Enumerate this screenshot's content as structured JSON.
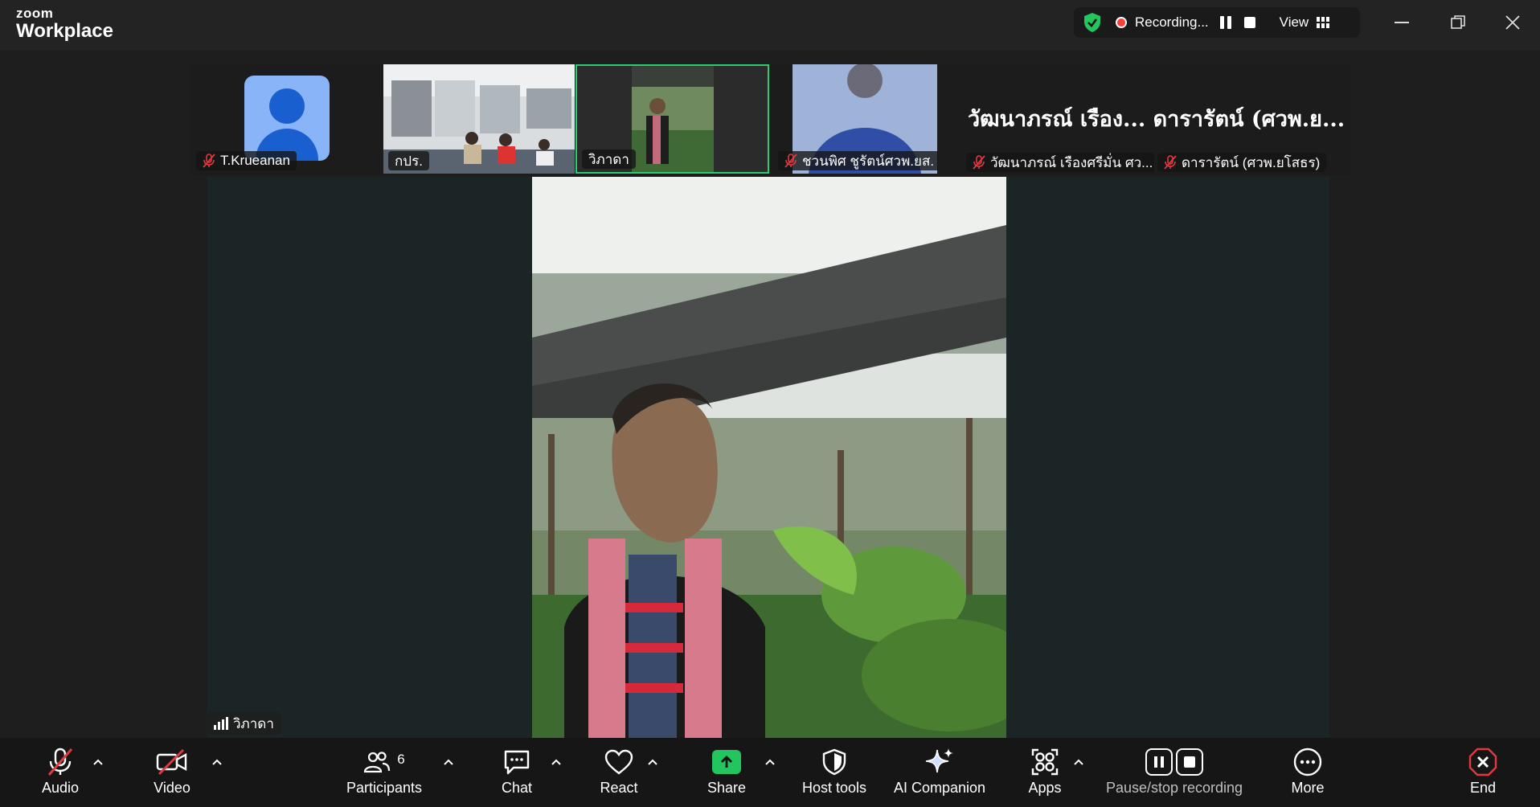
{
  "app": {
    "brand_top": "zoom",
    "brand_bottom": "Workplace"
  },
  "recording": {
    "status": "Recording...",
    "view_label": "View"
  },
  "participants_strip": [
    {
      "name": "T.Krueanan",
      "muted": true,
      "type": "avatar"
    },
    {
      "name": "กปร.",
      "muted": false,
      "type": "video"
    },
    {
      "name": "วิภาดา",
      "muted": false,
      "type": "video",
      "active": true
    },
    {
      "name": "ชวนพิศ ชูรัตน์ศวพ.ยส.",
      "muted": true,
      "type": "video"
    },
    {
      "name": "วัฒนาภรณ์ เรืองศรีมั่น ศว...",
      "muted": true,
      "type": "name"
    },
    {
      "name": "ดารารัตน์ (ศวพ.ยโสธร)",
      "muted": true,
      "type": "name"
    }
  ],
  "name_tiles_header": "วัฒนาภรณ์  เรือง...  ดารารัตน์ (ศวพ.ย...",
  "speaker": {
    "name": "วิภาดา"
  },
  "toolbar": {
    "audio": "Audio",
    "video": "Video",
    "participants": "Participants",
    "participants_count": "6",
    "chat": "Chat",
    "react": "React",
    "share": "Share",
    "host_tools": "Host tools",
    "ai_companion": "AI Companion",
    "apps": "Apps",
    "pause_stop": "Pause/stop recording",
    "more": "More",
    "end": "End"
  },
  "colors": {
    "accent_green": "#22c55e",
    "active_border": "#2ecc71",
    "muted_red": "#e0393e",
    "end_red": "#e0393e"
  }
}
